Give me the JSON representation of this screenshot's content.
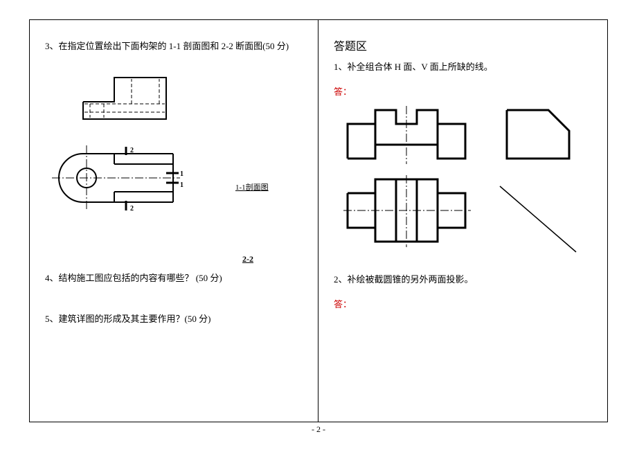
{
  "left": {
    "q3": "3、在指定位置绘出下面构架的 1-1 剖面图和 2-2 断面图(50 分)",
    "label11": "1-1剖面图",
    "label22": "2-2",
    "q4": "4、结构施工图应包括的内容有哪些？  (50 分)",
    "q5": "5、建筑详图的形成及其主要作用？(50 分)"
  },
  "right": {
    "title": "答题区",
    "q1": "1、补全组合体 H 面、V 面上所缺的线。",
    "a1": "答：",
    "q2": "2、补绘被截圆锥的另外两面投影。",
    "a2": "答："
  },
  "pageNum": "- 2 -"
}
